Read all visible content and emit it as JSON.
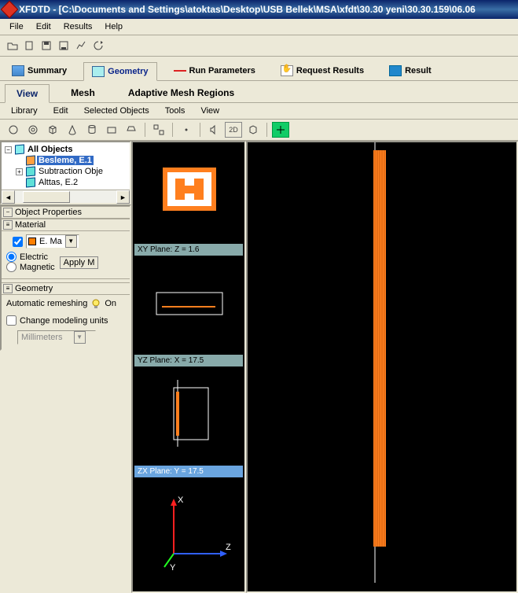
{
  "title": "XFDTD - [C:\\Documents and Settings\\atoktas\\Desktop\\USB Bellek\\MSA\\xfdt\\30.30 yeni\\30.30.159\\06.06",
  "menubar": [
    "File",
    "Edit",
    "Results",
    "Help"
  ],
  "maintabs": {
    "summary": "Summary",
    "geometry": "Geometry",
    "run": "Run Parameters",
    "request": "Request Results",
    "results": "Result"
  },
  "subtabs": {
    "view": "View",
    "mesh": "Mesh",
    "adaptive": "Adaptive Mesh Regions"
  },
  "submenubar": [
    "Library",
    "Edit",
    "Selected Objects",
    "Tools",
    "View"
  ],
  "tree": {
    "root": "All Objects",
    "items": [
      "Besleme, E.1",
      "Subtraction Obje",
      "Alttas, E.2"
    ]
  },
  "panels": {
    "obj_props": "Object Properties",
    "material": "Material",
    "mat_combo": "E. Ma",
    "electric": "Electric",
    "magnetic": "Magnetic",
    "apply": "Apply M",
    "geometry": "Geometry",
    "auto_remesh": "Automatic remeshing",
    "on": "On",
    "change_units": "Change modeling units",
    "units": "Millimeters"
  },
  "thumbs": {
    "xy": "XY Plane: Z = 1.6",
    "yz": "YZ Plane: X = 17.5",
    "zx": "ZX Plane: Y = 17.5"
  },
  "axes": {
    "x": "X",
    "y": "Y",
    "z": "Z"
  }
}
